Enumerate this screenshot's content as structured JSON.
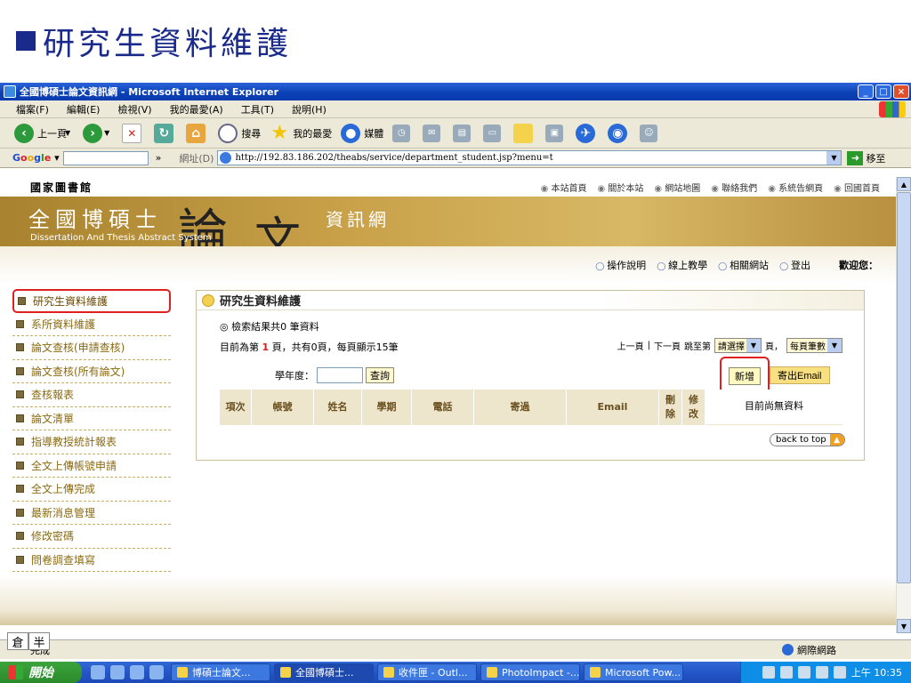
{
  "slide": {
    "title": "研究生資料維護"
  },
  "window": {
    "title": "全國博碩士論文資訊網 - Microsoft Internet Explorer",
    "controls": {
      "minimize": "_",
      "maximize": "□",
      "close": "×"
    }
  },
  "menu": [
    "檔案(F)",
    "編輯(E)",
    "檢視(V)",
    "我的最愛(A)",
    "工具(T)",
    "說明(H)"
  ],
  "toolbar": {
    "back": "上一頁",
    "search": "搜尋",
    "favorites": "我的最愛",
    "media": "媒體"
  },
  "addressbar": {
    "google": [
      "G",
      "o",
      "o",
      "g",
      "l",
      "e"
    ],
    "label": "網址(D)",
    "url": "http://192.83.186.202/theabs/service/department_student.jsp?menu=t",
    "go": "移至"
  },
  "site": {
    "library": "國家圖書館",
    "top_links": [
      "本站首頁",
      "關於本站",
      "網站地圖",
      "聯絡我們",
      "系統告網頁",
      "回國首頁"
    ],
    "banner_title": "全國博碩士",
    "banner_big1": "論",
    "banner_big2": "文",
    "banner_title2": "資訊網",
    "banner_sub": "Dissertation And Thesis Abstract System",
    "sub_nav": [
      "操作說明",
      "線上教學",
      "相關網站",
      "登出"
    ],
    "welcome": "歡迎您："
  },
  "sidebar": {
    "items": [
      {
        "label": "研究生資料維護"
      },
      {
        "label": "系所資料維護"
      },
      {
        "label": "論文查核(申請查核)"
      },
      {
        "label": "論文查核(所有論文)"
      },
      {
        "label": "查核報表"
      },
      {
        "label": "論文清單"
      },
      {
        "label": "指導教授統計報表"
      },
      {
        "label": "全文上傳帳號申請"
      },
      {
        "label": "全文上傳完成"
      },
      {
        "label": "最新消息管理"
      },
      {
        "label": "修改密碼"
      },
      {
        "label": "問卷調查填寫"
      }
    ]
  },
  "panel": {
    "heading": "研究生資料維護",
    "result": "檢索結果共0 筆資料",
    "pager_prefix": "目前為第",
    "pager_page": "1",
    "pager_suffix": "頁，共有0頁，每頁顯示15筆",
    "prev": "上一頁",
    "next": "下一頁",
    "jump": "跳至第",
    "jump_select": "請選擇",
    "page_unit": "頁，",
    "per_page_select": "每頁筆數",
    "year_label": "學年度：",
    "query_button": "查詢",
    "add_button": "新增",
    "email_button": "寄出Email",
    "columns": [
      "項次",
      "帳號",
      "姓名",
      "學期",
      "電話",
      "寄過",
      "Email",
      "刪除",
      "修改"
    ],
    "empty": "目前尚無資料",
    "back_to_top": "back to top"
  },
  "status": {
    "done": "完成",
    "zone": "網際網路"
  },
  "ime": [
    "倉",
    "半"
  ],
  "taskbar": {
    "start": "開始",
    "tasks": [
      "博碩士論文...",
      "全國博碩士...",
      "收件匣 - Outl...",
      "PhotoImpact -...",
      "Microsoft Pow..."
    ],
    "clock": "上午 10:35"
  }
}
